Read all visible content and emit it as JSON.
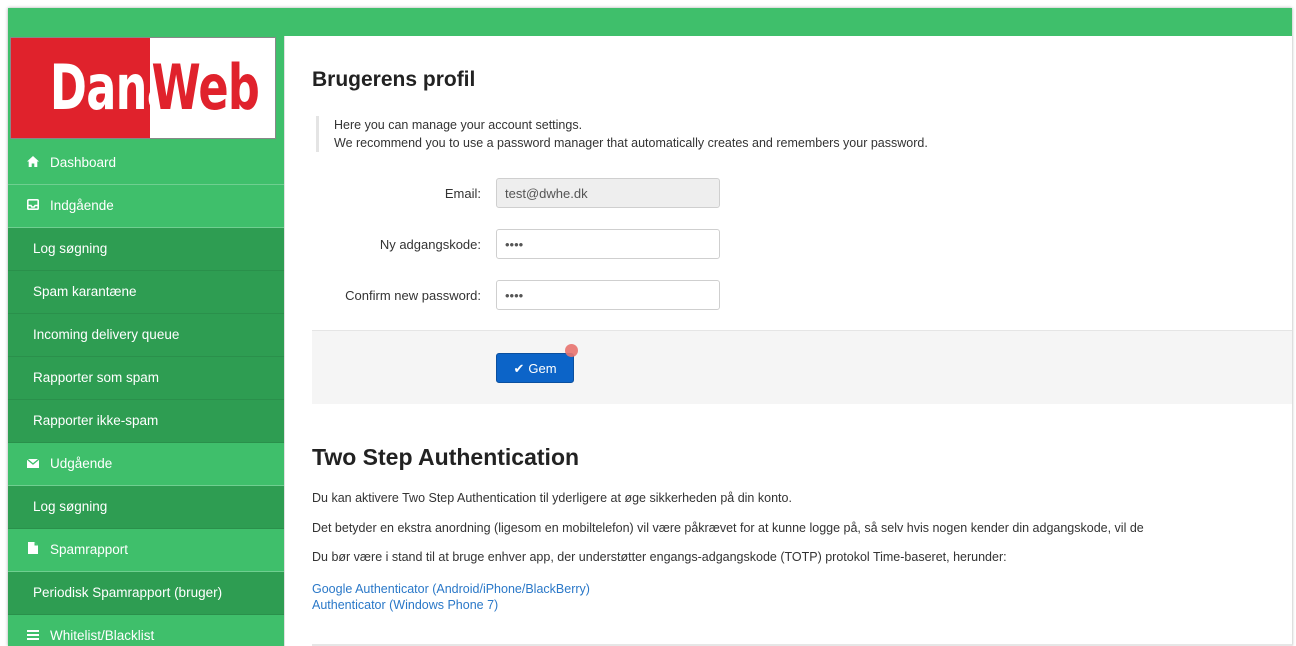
{
  "logo": {
    "left": "Dana",
    "right": "Web"
  },
  "colors": {
    "topbar": "#3fbf6b",
    "sidebar": "#3fbf6b",
    "sidebar_sub": "#2e9d52",
    "button": "#0c64c8",
    "link": "#2a78c8",
    "logo_red": "#e0222c"
  },
  "sidebar": {
    "items": [
      {
        "label": "Dashboard",
        "type": "top",
        "icon": "home-icon"
      },
      {
        "label": "Indgående",
        "type": "top",
        "icon": "inbox-icon"
      },
      {
        "label": "Log søgning",
        "type": "sub"
      },
      {
        "label": "Spam karantæne",
        "type": "sub"
      },
      {
        "label": "Incoming delivery queue",
        "type": "sub"
      },
      {
        "label": "Rapporter som spam",
        "type": "sub"
      },
      {
        "label": "Rapporter ikke-spam",
        "type": "sub"
      },
      {
        "label": "Udgående",
        "type": "top",
        "icon": "envelope-icon"
      },
      {
        "label": "Log søgning",
        "type": "sub"
      },
      {
        "label": "Spamrapport",
        "type": "top",
        "icon": "file-icon"
      },
      {
        "label": "Periodisk Spamrapport (bruger)",
        "type": "sub"
      },
      {
        "label": "Whitelist/Blacklist",
        "type": "top",
        "icon": "list-icon"
      }
    ]
  },
  "profile": {
    "title": "Brugerens profil",
    "note_line1": "Here you can manage your account settings.",
    "note_line2": "We recommend you to use a password manager that automatically creates and remembers your password.",
    "email_label": "Email:",
    "email_value": "test@dwhe.dk",
    "new_password_label": "Ny adgangskode:",
    "new_password_value": "••••",
    "confirm_label": "Confirm new password:",
    "confirm_value": "••••",
    "save_label": "Gem"
  },
  "two_step": {
    "title": "Two Step Authentication",
    "p1": "Du kan aktivere Two Step Authentication til yderligere at øge sikkerheden på din konto.",
    "p2": "Det betyder en ekstra anordning (ligesom en mobiltelefon) vil være påkrævet for at kunne logge på, så selv hvis nogen kender din adgangskode, vil de",
    "p3": "Du bør være i stand til at bruge enhver app, der understøtter engangs-adgangskode (TOTP) protokol Time-baseret, herunder:",
    "link1": "Google Authenticator (Android/iPhone/BlackBerry)",
    "link2": "Authenticator (Windows Phone 7)"
  }
}
